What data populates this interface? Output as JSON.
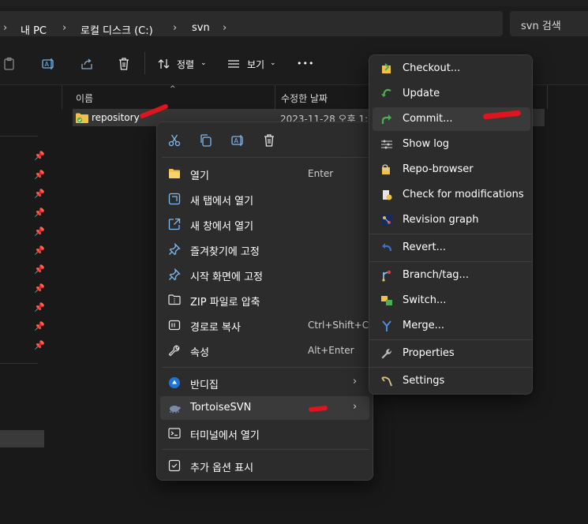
{
  "breadcrumb": {
    "items": [
      "내 PC",
      "로컬 디스크 (C:)",
      "svn"
    ],
    "separator": "›"
  },
  "search": {
    "placeholder": "svn 검색"
  },
  "toolbar": {
    "sort_label": "정렬",
    "view_label": "보기",
    "more_label": "•••"
  },
  "columns": {
    "name": "이름",
    "modified": "수정한 날짜"
  },
  "files": [
    {
      "name": "repository",
      "modified": "2023-11-28 오후 1:"
    }
  ],
  "context_menu": {
    "items": [
      {
        "label": "열기",
        "shortcut": "Enter",
        "icon": "folder-open-icon"
      },
      {
        "label": "새 탭에서 열기",
        "shortcut": "",
        "icon": "new-tab-icon"
      },
      {
        "label": "새 창에서 열기",
        "shortcut": "",
        "icon": "new-window-icon"
      },
      {
        "label": "즐겨찾기에 고정",
        "shortcut": "",
        "icon": "pin-icon"
      },
      {
        "label": "시작 화면에 고정",
        "shortcut": "",
        "icon": "pin-start-icon"
      },
      {
        "label": "ZIP 파일로 압축",
        "shortcut": "",
        "icon": "zip-icon"
      },
      {
        "label": "경로로 복사",
        "shortcut": "Ctrl+Shift+C",
        "icon": "copy-path-icon"
      },
      {
        "label": "속성",
        "shortcut": "Alt+Enter",
        "icon": "wrench-icon"
      },
      {
        "label": "반디집",
        "shortcut": "",
        "icon": "bandizip-icon"
      },
      {
        "label": "TortoiseSVN",
        "shortcut": "",
        "icon": "tortoise-icon"
      },
      {
        "label": "터미널에서 열기",
        "shortcut": "",
        "icon": "terminal-icon"
      },
      {
        "label": "추가 옵션 표시",
        "shortcut": "",
        "icon": "more-options-icon"
      }
    ]
  },
  "svn_menu": {
    "items": [
      {
        "label": "Checkout...",
        "icon": "checkout-icon"
      },
      {
        "label": "Update",
        "icon": "update-icon"
      },
      {
        "label": "Commit...",
        "icon": "commit-icon"
      },
      {
        "label": "Show log",
        "icon": "log-icon"
      },
      {
        "label": "Repo-browser",
        "icon": "repo-browser-icon"
      },
      {
        "label": "Check for modifications",
        "icon": "check-modifications-icon"
      },
      {
        "label": "Revision graph",
        "icon": "revision-graph-icon"
      },
      {
        "label": "Revert...",
        "icon": "revert-icon"
      },
      {
        "label": "Branch/tag...",
        "icon": "branch-icon"
      },
      {
        "label": "Switch...",
        "icon": "switch-icon"
      },
      {
        "label": "Merge...",
        "icon": "merge-icon"
      },
      {
        "label": "Properties",
        "icon": "properties-icon"
      },
      {
        "label": "Settings",
        "icon": "settings-icon"
      }
    ]
  },
  "colors": {
    "background": "#191919",
    "menu_bg": "#2c2c2c",
    "highlight": "#3a3a3a",
    "annotation_red": "#e0141e",
    "folder_yellow": "#f2c045",
    "svn_green": "#4caf50",
    "accent_blue": "#4aa3e8"
  }
}
